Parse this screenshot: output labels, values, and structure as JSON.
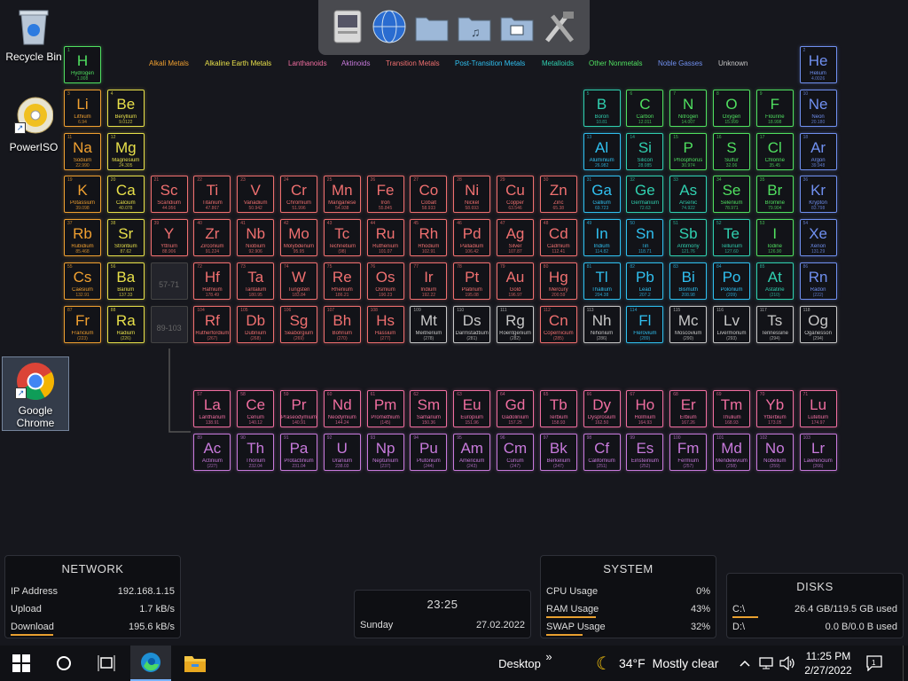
{
  "desktop": {
    "recycle_bin": "Recycle Bin",
    "poweriso": "PowerISO",
    "chrome": "Google Chrome"
  },
  "dock": {
    "icons": [
      "finder-icon",
      "globe-icon",
      "folder-icon",
      "music-folder-icon",
      "pictures-folder-icon",
      "tools-icon"
    ]
  },
  "colors": {
    "alkali": "#f0a030",
    "alkaline": "#e8e04a",
    "lanthanoid": "#f06ea0",
    "actinoid": "#c87adc",
    "transition": "#f07070",
    "post": "#30c0f0",
    "metalloid": "#30d0b0",
    "nonmetal": "#50e060",
    "noble": "#7090f0",
    "unknown": "#c8c8c8"
  },
  "legend": [
    {
      "label": "Alkali Metals",
      "cat": "alkali"
    },
    {
      "label": "Alkaline Earth Metals",
      "cat": "alkaline"
    },
    {
      "label": "Lanthanoids",
      "cat": "lanthanoid"
    },
    {
      "label": "Aktinoids",
      "cat": "actinoid"
    },
    {
      "label": "Transition Metals",
      "cat": "transition"
    },
    {
      "label": "Post-Transition Metals",
      "cat": "post"
    },
    {
      "label": "Metalloids",
      "cat": "metalloid"
    },
    {
      "label": "Other Nonmetals",
      "cat": "nonmetal"
    },
    {
      "label": "Noble Gasses",
      "cat": "noble"
    },
    {
      "label": "Unknown",
      "cat": "unknown"
    }
  ],
  "placeholders": [
    "57-71",
    "89-103"
  ],
  "elements": [
    [
      "1",
      "H",
      "Hydrogen",
      "1.008",
      "nonmetal",
      1,
      1
    ],
    [
      "2",
      "He",
      "Helium",
      "4.0026",
      "noble",
      18,
      1
    ],
    [
      "3",
      "Li",
      "Lithium",
      "6.94",
      "alkali",
      1,
      2
    ],
    [
      "4",
      "Be",
      "Beryllium",
      "9.0122",
      "alkaline",
      2,
      2
    ],
    [
      "5",
      "B",
      "Boron",
      "10.81",
      "metalloid",
      13,
      2
    ],
    [
      "6",
      "C",
      "Carbon",
      "12.011",
      "nonmetal",
      14,
      2
    ],
    [
      "7",
      "N",
      "Nitrogen",
      "14.007",
      "nonmetal",
      15,
      2
    ],
    [
      "8",
      "O",
      "Oxygen",
      "15.999",
      "nonmetal",
      16,
      2
    ],
    [
      "9",
      "F",
      "Flourine",
      "18.998",
      "nonmetal",
      17,
      2
    ],
    [
      "10",
      "Ne",
      "Neon",
      "20.180",
      "noble",
      18,
      2
    ],
    [
      "11",
      "Na",
      "Sodium",
      "22.990",
      "alkali",
      1,
      3
    ],
    [
      "12",
      "Mg",
      "Magnesium",
      "24.305",
      "alkaline",
      2,
      3
    ],
    [
      "13",
      "Al",
      "Aluminium",
      "26.982",
      "post",
      13,
      3
    ],
    [
      "14",
      "Si",
      "Silicon",
      "28.085",
      "metalloid",
      14,
      3
    ],
    [
      "15",
      "P",
      "Phosphorus",
      "30.974",
      "nonmetal",
      15,
      3
    ],
    [
      "16",
      "S",
      "Sulfur",
      "32.06",
      "nonmetal",
      16,
      3
    ],
    [
      "17",
      "Cl",
      "Chlorine",
      "35.45",
      "nonmetal",
      17,
      3
    ],
    [
      "18",
      "Ar",
      "Argon",
      "39.948",
      "noble",
      18,
      3
    ],
    [
      "19",
      "K",
      "Potassium",
      "39.098",
      "alkali",
      1,
      4
    ],
    [
      "20",
      "Ca",
      "Calcium",
      "40.078",
      "alkaline",
      2,
      4
    ],
    [
      "21",
      "Sc",
      "Scandium",
      "44.956",
      "transition",
      3,
      4
    ],
    [
      "22",
      "Ti",
      "Titanium",
      "47.867",
      "transition",
      4,
      4
    ],
    [
      "23",
      "V",
      "Vanadium",
      "50.942",
      "transition",
      5,
      4
    ],
    [
      "24",
      "Cr",
      "Chromium",
      "51.996",
      "transition",
      6,
      4
    ],
    [
      "25",
      "Mn",
      "Manganese",
      "54.938",
      "transition",
      7,
      4
    ],
    [
      "26",
      "Fe",
      "Iron",
      "55.845",
      "transition",
      8,
      4
    ],
    [
      "27",
      "Co",
      "Cobalt",
      "58.933",
      "transition",
      9,
      4
    ],
    [
      "28",
      "Ni",
      "Nickel",
      "58.693",
      "transition",
      10,
      4
    ],
    [
      "29",
      "Cu",
      "Copper",
      "63.546",
      "transition",
      11,
      4
    ],
    [
      "30",
      "Zn",
      "Zinc",
      "65.38",
      "transition",
      12,
      4
    ],
    [
      "31",
      "Ga",
      "Gallium",
      "69.723",
      "post",
      13,
      4
    ],
    [
      "32",
      "Ge",
      "Germanium",
      "72.63",
      "metalloid",
      14,
      4
    ],
    [
      "33",
      "As",
      "Arsenic",
      "74.922",
      "metalloid",
      15,
      4
    ],
    [
      "34",
      "Se",
      "Selenium",
      "78.971",
      "nonmetal",
      16,
      4
    ],
    [
      "35",
      "Br",
      "Bromine",
      "79.904",
      "nonmetal",
      17,
      4
    ],
    [
      "36",
      "Kr",
      "Krypton",
      "83.798",
      "noble",
      18,
      4
    ],
    [
      "37",
      "Rb",
      "Rubidium",
      "85.468",
      "alkali",
      1,
      5
    ],
    [
      "38",
      "Sr",
      "Strontium",
      "87.62",
      "alkaline",
      2,
      5
    ],
    [
      "39",
      "Y",
      "Yttrium",
      "88.906",
      "transition",
      3,
      5
    ],
    [
      "40",
      "Zr",
      "Zirconium",
      "91.224",
      "transition",
      4,
      5
    ],
    [
      "41",
      "Nb",
      "Niobium",
      "92.906",
      "transition",
      5,
      5
    ],
    [
      "42",
      "Mo",
      "Molybdenum",
      "95.95",
      "transition",
      6,
      5
    ],
    [
      "43",
      "Tc",
      "Technetium",
      "(98)",
      "transition",
      7,
      5
    ],
    [
      "44",
      "Ru",
      "Ruthenium",
      "101.07",
      "transition",
      8,
      5
    ],
    [
      "45",
      "Rh",
      "Rhodium",
      "102.91",
      "transition",
      9,
      5
    ],
    [
      "46",
      "Pd",
      "Palladium",
      "106.42",
      "transition",
      10,
      5
    ],
    [
      "47",
      "Ag",
      "Silver",
      "107.87",
      "transition",
      11,
      5
    ],
    [
      "48",
      "Cd",
      "Cadmium",
      "112.41",
      "transition",
      12,
      5
    ],
    [
      "49",
      "In",
      "Indium",
      "114.82",
      "post",
      13,
      5
    ],
    [
      "50",
      "Sn",
      "Tin",
      "118.71",
      "post",
      14,
      5
    ],
    [
      "51",
      "Sb",
      "Antimony",
      "121.76",
      "metalloid",
      15,
      5
    ],
    [
      "52",
      "Te",
      "Tellurium",
      "127.60",
      "metalloid",
      16,
      5
    ],
    [
      "53",
      "I",
      "Iodine",
      "126.90",
      "nonmetal",
      17,
      5
    ],
    [
      "54",
      "Xe",
      "Xenon",
      "131.29",
      "noble",
      18,
      5
    ],
    [
      "55",
      "Cs",
      "Caesium",
      "132.91",
      "alkali",
      1,
      6
    ],
    [
      "56",
      "Ba",
      "Barium",
      "137.33",
      "alkaline",
      2,
      6
    ],
    [
      "72",
      "Hf",
      "Hafnium",
      "178.49",
      "transition",
      4,
      6
    ],
    [
      "73",
      "Ta",
      "Tantalum",
      "180.95",
      "transition",
      5,
      6
    ],
    [
      "74",
      "W",
      "Tungsten",
      "183.84",
      "transition",
      6,
      6
    ],
    [
      "75",
      "Re",
      "Rhenium",
      "186.21",
      "transition",
      7,
      6
    ],
    [
      "76",
      "Os",
      "Osmium",
      "190.23",
      "transition",
      8,
      6
    ],
    [
      "77",
      "Ir",
      "Iridium",
      "192.22",
      "transition",
      9,
      6
    ],
    [
      "78",
      "Pt",
      "Platinum",
      "195.08",
      "transition",
      10,
      6
    ],
    [
      "79",
      "Au",
      "Gold",
      "196.97",
      "transition",
      11,
      6
    ],
    [
      "80",
      "Hg",
      "Mercury",
      "200.59",
      "transition",
      12,
      6
    ],
    [
      "81",
      "Tl",
      "Thallium",
      "204.38",
      "post",
      13,
      6
    ],
    [
      "82",
      "Pb",
      "Lead",
      "207.2",
      "post",
      14,
      6
    ],
    [
      "83",
      "Bi",
      "Bismuth",
      "208.98",
      "post",
      15,
      6
    ],
    [
      "84",
      "Po",
      "Polonium",
      "(209)",
      "post",
      16,
      6
    ],
    [
      "85",
      "At",
      "Astatine",
      "(210)",
      "metalloid",
      17,
      6
    ],
    [
      "86",
      "Rn",
      "Radon",
      "(222)",
      "noble",
      18,
      6
    ],
    [
      "87",
      "Fr",
      "Francium",
      "(223)",
      "alkali",
      1,
      7
    ],
    [
      "88",
      "Ra",
      "Radium",
      "(226)",
      "alkaline",
      2,
      7
    ],
    [
      "104",
      "Rf",
      "Rutherfordium",
      "(267)",
      "transition",
      4,
      7
    ],
    [
      "105",
      "Db",
      "Dubnium",
      "(268)",
      "transition",
      5,
      7
    ],
    [
      "106",
      "Sg",
      "Seaborgium",
      "(269)",
      "transition",
      6,
      7
    ],
    [
      "107",
      "Bh",
      "Bohrium",
      "(270)",
      "transition",
      7,
      7
    ],
    [
      "108",
      "Hs",
      "Hassium",
      "(277)",
      "transition",
      8,
      7
    ],
    [
      "109",
      "Mt",
      "Meitnerium",
      "(278)",
      "unknown",
      9,
      7
    ],
    [
      "110",
      "Ds",
      "Darmstadtium",
      "(281)",
      "unknown",
      10,
      7
    ],
    [
      "111",
      "Rg",
      "Roentgenium",
      "(282)",
      "unknown",
      11,
      7
    ],
    [
      "112",
      "Cn",
      "Copernicium",
      "(285)",
      "transition",
      12,
      7
    ],
    [
      "113",
      "Nh",
      "Nihonium",
      "(286)",
      "unknown",
      13,
      7
    ],
    [
      "114",
      "Fl",
      "Flerovium",
      "(289)",
      "post",
      14,
      7
    ],
    [
      "115",
      "Mc",
      "Moscovium",
      "(290)",
      "unknown",
      15,
      7
    ],
    [
      "116",
      "Lv",
      "Livermorium",
      "(293)",
      "unknown",
      16,
      7
    ],
    [
      "117",
      "Ts",
      "Tennessine",
      "(294)",
      "unknown",
      17,
      7
    ],
    [
      "118",
      "Og",
      "Oganesson",
      "(294)",
      "unknown",
      18,
      7
    ],
    [
      "57",
      "La",
      "Lanthanum",
      "138.91",
      "lanthanoid",
      4,
      9
    ],
    [
      "58",
      "Ce",
      "Cerium",
      "140.12",
      "lanthanoid",
      5,
      9
    ],
    [
      "59",
      "Pr",
      "Praseodymium",
      "140.91",
      "lanthanoid",
      6,
      9
    ],
    [
      "60",
      "Nd",
      "Neodymium",
      "144.24",
      "lanthanoid",
      7,
      9
    ],
    [
      "61",
      "Pm",
      "Promethium",
      "(145)",
      "lanthanoid",
      8,
      9
    ],
    [
      "62",
      "Sm",
      "Samarium",
      "150.36",
      "lanthanoid",
      9,
      9
    ],
    [
      "63",
      "Eu",
      "Europium",
      "151.96",
      "lanthanoid",
      10,
      9
    ],
    [
      "64",
      "Gd",
      "Gadolinium",
      "157.25",
      "lanthanoid",
      11,
      9
    ],
    [
      "65",
      "Tb",
      "Terbium",
      "158.93",
      "lanthanoid",
      12,
      9
    ],
    [
      "66",
      "Dy",
      "Dysprosium",
      "162.50",
      "lanthanoid",
      13,
      9
    ],
    [
      "67",
      "Ho",
      "Holmium",
      "164.93",
      "lanthanoid",
      14,
      9
    ],
    [
      "68",
      "Er",
      "Erbium",
      "167.26",
      "lanthanoid",
      15,
      9
    ],
    [
      "69",
      "Tm",
      "Thulium",
      "168.93",
      "lanthanoid",
      16,
      9
    ],
    [
      "70",
      "Yb",
      "Ytterbium",
      "173.05",
      "lanthanoid",
      17,
      9
    ],
    [
      "71",
      "Lu",
      "Lutetium",
      "174.97",
      "lanthanoid",
      18,
      9
    ],
    [
      "89",
      "Ac",
      "Actinium",
      "(227)",
      "actinoid",
      4,
      10
    ],
    [
      "90",
      "Th",
      "Thorium",
      "232.04",
      "actinoid",
      5,
      10
    ],
    [
      "91",
      "Pa",
      "Protactinium",
      "231.04",
      "actinoid",
      6,
      10
    ],
    [
      "92",
      "U",
      "Uranium",
      "238.03",
      "actinoid",
      7,
      10
    ],
    [
      "93",
      "Np",
      "Neptunium",
      "(237)",
      "actinoid",
      8,
      10
    ],
    [
      "94",
      "Pu",
      "Plutonium",
      "(244)",
      "actinoid",
      9,
      10
    ],
    [
      "95",
      "Am",
      "Americium",
      "(243)",
      "actinoid",
      10,
      10
    ],
    [
      "96",
      "Cm",
      "Curium",
      "(247)",
      "actinoid",
      11,
      10
    ],
    [
      "97",
      "Bk",
      "Berkelium",
      "(247)",
      "actinoid",
      12,
      10
    ],
    [
      "98",
      "Cf",
      "Californium",
      "(251)",
      "actinoid",
      13,
      10
    ],
    [
      "99",
      "Es",
      "Einsteinium",
      "(252)",
      "actinoid",
      14,
      10
    ],
    [
      "100",
      "Fm",
      "Fermium",
      "(257)",
      "actinoid",
      15,
      10
    ],
    [
      "101",
      "Md",
      "Mendelevium",
      "(258)",
      "actinoid",
      16,
      10
    ],
    [
      "102",
      "No",
      "Nobelium",
      "(259)",
      "actinoid",
      17,
      10
    ],
    [
      "103",
      "Lr",
      "Lawrencium",
      "(266)",
      "actinoid",
      18,
      10
    ]
  ],
  "network": {
    "title": "NETWORK",
    "rows": [
      {
        "k": "IP Address",
        "v": "192.168.1.15"
      },
      {
        "k": "Upload",
        "v": "1.7 kB/s"
      },
      {
        "k": "Download",
        "v": "195.6 kB/s"
      }
    ]
  },
  "clock": {
    "time": "23:25",
    "day": "Sunday",
    "date": "27.02.2022"
  },
  "system": {
    "title": "SYSTEM",
    "rows": [
      {
        "k": "CPU Usage",
        "v": "0%",
        "level": 0
      },
      {
        "k": "RAM Usage",
        "v": "43%",
        "level": 43
      },
      {
        "k": "SWAP Usage",
        "v": "32%",
        "level": 32
      }
    ]
  },
  "disks": {
    "title": "DISKS",
    "rows": [
      {
        "k": "C:\\",
        "v": "26.4 GB/119.5 GB used",
        "level": 22
      },
      {
        "k": "D:\\",
        "v": "0.0 B/0.0 B used",
        "level": 0
      }
    ]
  },
  "taskbar": {
    "desktop_label": "Desktop",
    "chevron": "»",
    "weather_temp": "34°F",
    "weather_text": "Mostly clear",
    "time": "11:25 PM",
    "date": "2/27/2022"
  }
}
